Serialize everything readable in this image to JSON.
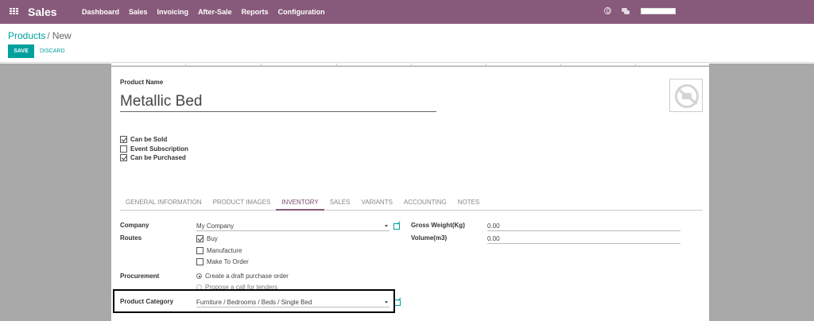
{
  "navbar": {
    "brand": "Sales",
    "menu": [
      "Dashboard",
      "Sales",
      "Invoicing",
      "After-Sale",
      "Reports",
      "Configuration"
    ],
    "colors": {
      "primary": "#875a7b",
      "accent": "#00a09d"
    }
  },
  "breadcrumb": {
    "parent": "Products",
    "separator": "/",
    "current": "New"
  },
  "buttons": {
    "save": "SAVE",
    "discard": "DISCARD"
  },
  "product": {
    "name_label": "Product Name",
    "name_value": "Metallic Bed",
    "image_icon": "camera-icon"
  },
  "flags": [
    {
      "label": "Can be Sold",
      "checked": true
    },
    {
      "label": "Event Subscription",
      "checked": false
    },
    {
      "label": "Can be Purchased",
      "checked": true
    }
  ],
  "tabs": [
    "GENERAL INFORMATION",
    "PRODUCT IMAGES",
    "INVENTORY",
    "SALES",
    "VARIANTS",
    "ACCOUNTING",
    "NOTES"
  ],
  "active_tab": "INVENTORY",
  "inventory": {
    "company_label": "Company",
    "company_value": "My Company",
    "routes_label": "Routes",
    "routes": [
      {
        "label": "Buy",
        "checked": true
      },
      {
        "label": "Manufacture",
        "checked": false
      },
      {
        "label": "Make To Order",
        "checked": false
      }
    ],
    "procurement_label": "Procurement",
    "procurement_options": [
      {
        "label": "Create a draft purchase order",
        "selected": true
      },
      {
        "label": "Propose a call for tenders",
        "selected": false
      }
    ],
    "category_label": "Product Category",
    "category_value": "Furniture / Bedrooms / Beds / Single Bed",
    "gross_weight_label": "Gross Weight(Kg)",
    "gross_weight_value": "0.00",
    "volume_label": "Volume(m3)",
    "volume_value": "0.00"
  }
}
